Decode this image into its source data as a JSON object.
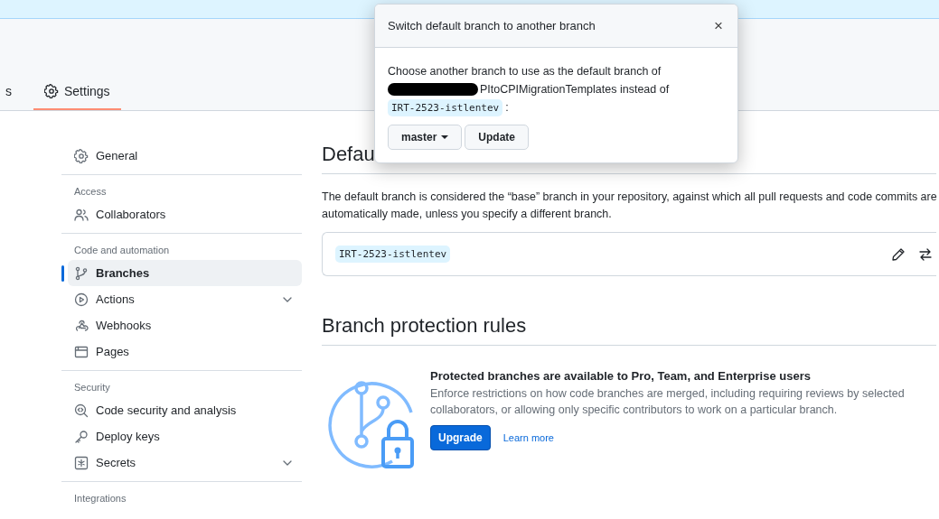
{
  "header": {
    "tabs": [
      {
        "label": "s",
        "selected": false
      },
      {
        "label": "Settings",
        "kind": "gear",
        "selected": true
      }
    ]
  },
  "sidebar": {
    "groups": [
      {
        "items": [
          {
            "label": "General",
            "kind": "gear",
            "selected": false,
            "expandable": false
          }
        ]
      },
      {
        "heading": "Access",
        "items": [
          {
            "label": "Collaborators",
            "kind": "people",
            "selected": false,
            "expandable": false
          }
        ]
      },
      {
        "heading": "Code and automation",
        "items": [
          {
            "label": "Branches",
            "kind": "branch",
            "selected": true,
            "expandable": false
          },
          {
            "label": "Actions",
            "kind": "play",
            "selected": false,
            "expandable": true
          },
          {
            "label": "Webhooks",
            "kind": "webhook",
            "selected": false,
            "expandable": false
          },
          {
            "label": "Pages",
            "kind": "browser",
            "selected": false,
            "expandable": false
          }
        ]
      },
      {
        "heading": "Security",
        "items": [
          {
            "label": "Code security and analysis",
            "kind": "codescan",
            "selected": false,
            "expandable": false
          },
          {
            "label": "Deploy keys",
            "kind": "key",
            "selected": false,
            "expandable": false
          },
          {
            "label": "Secrets",
            "kind": "asterisk",
            "selected": false,
            "expandable": true
          }
        ]
      },
      {
        "heading": "Integrations"
      }
    ]
  },
  "default_branch": {
    "heading": "Defau",
    "description": "The default branch is considered the “base” branch in your repository, against which all pull requests and code commits are automatically made, unless you specify a different branch.",
    "branch": "IRT-2523-istlentev"
  },
  "protection": {
    "heading": "Branch protection rules",
    "title": "Protected branches are available to Pro, Team, and Enterprise users",
    "description": "Enforce restrictions on how code branches are merged, including requiring reviews by selected collaborators, or allowing only specific contributors to work on a particular branch.",
    "upgrade": "Upgrade",
    "learn_more": "Learn more"
  },
  "dialog": {
    "title": "Switch default branch to another branch",
    "close": "×",
    "text_before": "Choose another branch to use as the default branch of",
    "redacted": true,
    "repo_suffix": "PItoCPIMigrationTemplates instead of",
    "current_branch": "IRT-2523-istlentev",
    "colon": ":",
    "branch_select": "master",
    "update": "Update"
  }
}
